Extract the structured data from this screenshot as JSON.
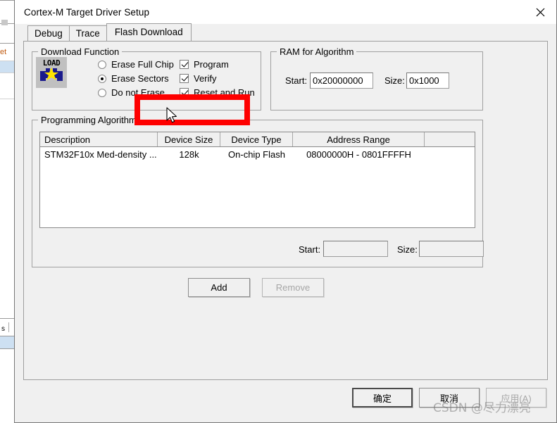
{
  "window": {
    "title": "Cortex-M Target Driver Setup",
    "close_icon": "close-icon"
  },
  "tabs": [
    {
      "label": "Debug",
      "active": false
    },
    {
      "label": "Trace",
      "active": false
    },
    {
      "label": "Flash Download",
      "active": true
    }
  ],
  "download_function": {
    "legend": "Download Function",
    "icon_label": "LOAD",
    "erase_options": [
      {
        "label": "Erase Full Chip",
        "selected": false
      },
      {
        "label": "Erase Sectors",
        "selected": true
      },
      {
        "label": "Do not Erase",
        "selected": false
      }
    ],
    "checkboxes": [
      {
        "label": "Program",
        "checked": true
      },
      {
        "label": "Verify",
        "checked": true
      },
      {
        "label": "Reset and Run",
        "checked": true
      }
    ]
  },
  "ram_for_algorithm": {
    "legend": "RAM for Algorithm",
    "start_label": "Start:",
    "start_value": "0x20000000",
    "size_label": "Size:",
    "size_value": "0x1000"
  },
  "programming_algorithm": {
    "legend": "Programming Algorithm",
    "columns": [
      "Description",
      "Device Size",
      "Device Type",
      "Address Range",
      ""
    ],
    "rows": [
      {
        "description": "STM32F10x Med-density ...",
        "device_size": "128k",
        "device_type": "On-chip Flash",
        "address_range": "08000000H - 0801FFFFH"
      }
    ],
    "start_label": "Start:",
    "start_value": "",
    "size_label": "Size:",
    "size_value": "",
    "add_button": "Add",
    "remove_button": "Remove"
  },
  "footer": {
    "ok_button": "确定",
    "cancel_button": "取消",
    "apply_button": "应用(A)"
  },
  "watermark": "CSDN @尽力漂亮",
  "background_fragments": {
    "frag_top": "et",
    "frag_bottom": "s"
  },
  "colors": {
    "highlight": "#fe0000",
    "dialog_bg": "#f0f0f0",
    "field_bg": "#ffffff",
    "disabled_text": "#a6a6a6"
  }
}
